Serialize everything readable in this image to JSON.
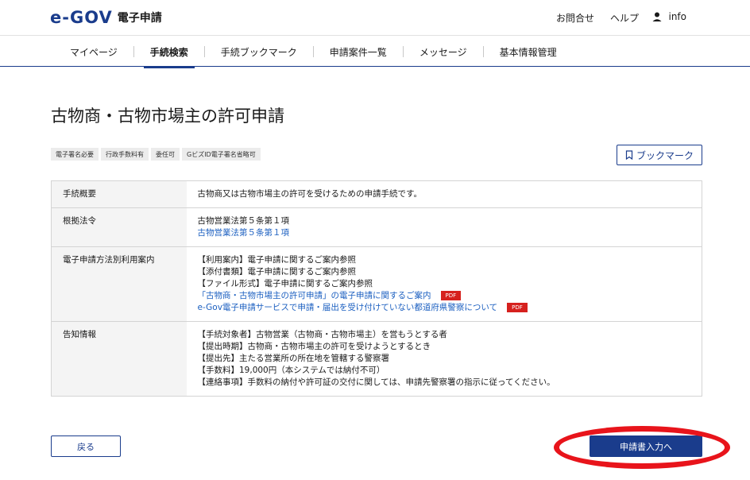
{
  "header": {
    "logo_text": "e-GOV",
    "logo_sub": "電子申請",
    "links": [
      "お問合せ",
      "ヘルプ"
    ],
    "user_icon": "user-icon",
    "user_name": "info"
  },
  "nav": {
    "items": [
      {
        "label": "マイページ",
        "active": false
      },
      {
        "label": "手続検索",
        "active": true
      },
      {
        "label": "手続ブックマーク",
        "active": false
      },
      {
        "label": "申請案件一覧",
        "active": false
      },
      {
        "label": "メッセージ",
        "active": false
      },
      {
        "label": "基本情報管理",
        "active": false
      }
    ]
  },
  "page_title": "古物商・古物市場主の許可申請",
  "tags": [
    "電子署名必要",
    "行政手数料有",
    "委任可",
    "GビズID電子署名省略可"
  ],
  "bookmark_button": {
    "icon": "bookmark-icon",
    "label": "ブックマーク"
  },
  "table": {
    "rows": [
      {
        "header": "手続概要",
        "lines": [
          {
            "text": "古物商又は古物市場主の許可を受けるための申請手続です。",
            "link": false
          }
        ]
      },
      {
        "header": "根拠法令",
        "lines": [
          {
            "text": "古物営業法第５条第１項",
            "link": false
          },
          {
            "text": "古物営業法第５条第１項",
            "link": true
          }
        ]
      },
      {
        "header": "電子申請方法別利用案内",
        "lines": [
          {
            "text": "【利用案内】電子申請に関するご案内参照",
            "link": false
          },
          {
            "text": "【添付書類】電子申請に関するご案内参照",
            "link": false
          },
          {
            "text": "【ファイル形式】電子申請に関するご案内参照",
            "link": false
          },
          {
            "text": "「古物商・古物市場主の許可申請」の電子申請に関するご案内",
            "link": true,
            "pdf": "PDF"
          },
          {
            "text": "e-Gov電子申請サービスで申請・届出を受け付けていない都道府県警察について",
            "link": true,
            "pdf": "PDF"
          }
        ]
      },
      {
        "header": "告知情報",
        "lines": [
          {
            "text": "【手続対象者】古物営業（古物商・古物市場主）を営もうとする者",
            "link": false
          },
          {
            "text": "【提出時期】古物商・古物市場主の許可を受けようとするとき",
            "link": false
          },
          {
            "text": "【提出先】主たる営業所の所在地を管轄する警察署",
            "link": false
          },
          {
            "text": "【手数料】19,000円（本システムでは納付不可）",
            "link": false
          },
          {
            "text": "【連絡事項】手数料の納付や許可証の交付に関しては、申請先警察署の指示に従ってください。",
            "link": false
          }
        ]
      }
    ]
  },
  "back_button": "戻る",
  "apply_button": "申請書入力へ",
  "colors": {
    "brand": "#1a3c8c",
    "link": "#1b5fc0",
    "pdf_badge": "#d6211e",
    "highlight_ring": "#e8141b"
  }
}
